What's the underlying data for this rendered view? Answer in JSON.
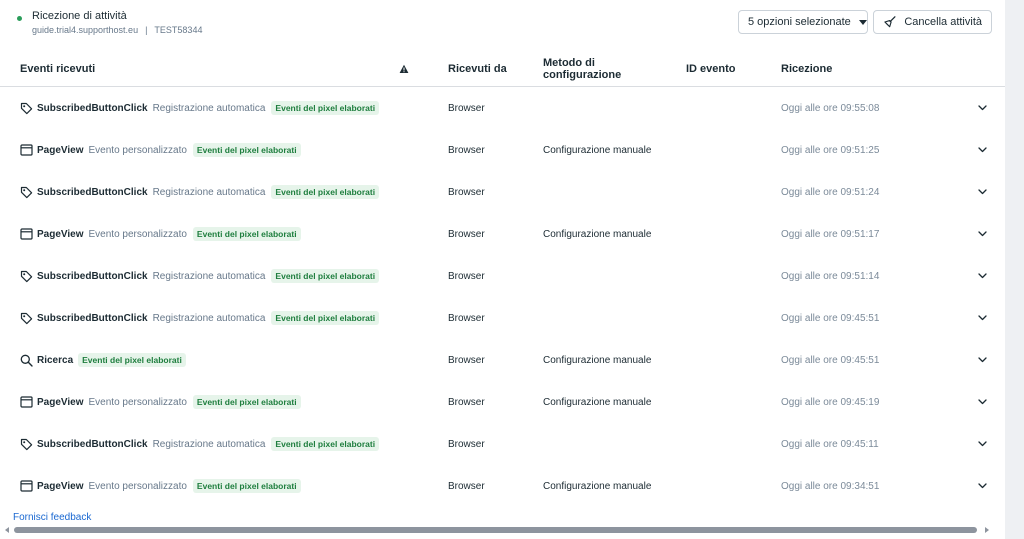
{
  "header": {
    "title": "Ricezione di attività",
    "domain": "guide.trial4.supporthost.eu",
    "separator": "|",
    "pixel_id": "TEST58344",
    "status_color": "#2a9d5a",
    "filter_label": "5 opzioni selezionate",
    "clear_label": "Cancella attività"
  },
  "table": {
    "columns": {
      "events": "Eventi ricevuti",
      "warning_icon": "warning-icon",
      "received_by": "Ricevuti da",
      "method": "Metodo di configurazione",
      "event_id": "ID evento",
      "reception": "Ricezione"
    },
    "rows": [
      {
        "icon": "tag-icon",
        "name": "SubscribedButtonClick",
        "type": "Registrazione automatica",
        "badge": "Eventi del pixel elaborati",
        "source": "Browser",
        "method": "",
        "time": "Oggi alle ore 09:55:08"
      },
      {
        "icon": "window-icon",
        "name": "PageView",
        "type": "Evento personalizzato",
        "badge": "Eventi del pixel elaborati",
        "source": "Browser",
        "method": "Configurazione manuale",
        "time": "Oggi alle ore 09:51:25"
      },
      {
        "icon": "tag-icon",
        "name": "SubscribedButtonClick",
        "type": "Registrazione automatica",
        "badge": "Eventi del pixel elaborati",
        "source": "Browser",
        "method": "",
        "time": "Oggi alle ore 09:51:24"
      },
      {
        "icon": "window-icon",
        "name": "PageView",
        "type": "Evento personalizzato",
        "badge": "Eventi del pixel elaborati",
        "source": "Browser",
        "method": "Configurazione manuale",
        "time": "Oggi alle ore 09:51:17"
      },
      {
        "icon": "tag-icon",
        "name": "SubscribedButtonClick",
        "type": "Registrazione automatica",
        "badge": "Eventi del pixel elaborati",
        "source": "Browser",
        "method": "",
        "time": "Oggi alle ore 09:51:14"
      },
      {
        "icon": "tag-icon",
        "name": "SubscribedButtonClick",
        "type": "Registrazione automatica",
        "badge": "Eventi del pixel elaborati",
        "source": "Browser",
        "method": "",
        "time": "Oggi alle ore 09:45:51"
      },
      {
        "icon": "search-icon",
        "name": "Ricerca",
        "type": "",
        "badge": "Eventi del pixel elaborati",
        "source": "Browser",
        "method": "Configurazione manuale",
        "time": "Oggi alle ore 09:45:51"
      },
      {
        "icon": "window-icon",
        "name": "PageView",
        "type": "Evento personalizzato",
        "badge": "Eventi del pixel elaborati",
        "source": "Browser",
        "method": "Configurazione manuale",
        "time": "Oggi alle ore 09:45:19"
      },
      {
        "icon": "tag-icon",
        "name": "SubscribedButtonClick",
        "type": "Registrazione automatica",
        "badge": "Eventi del pixel elaborati",
        "source": "Browser",
        "method": "",
        "time": "Oggi alle ore 09:45:11"
      },
      {
        "icon": "window-icon",
        "name": "PageView",
        "type": "Evento personalizzato",
        "badge": "Eventi del pixel elaborati",
        "source": "Browser",
        "method": "Configurazione manuale",
        "time": "Oggi alle ore 09:34:51"
      }
    ]
  },
  "footer": {
    "feedback_label": "Fornisci feedback"
  }
}
